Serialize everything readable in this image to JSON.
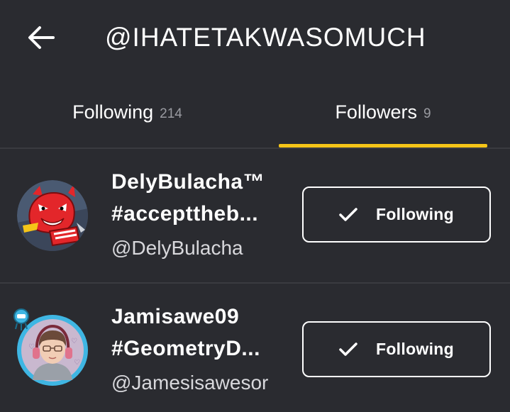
{
  "header": {
    "title": "@IHATETAKWASOMUCH",
    "back_icon": "back-arrow-icon"
  },
  "tabs": [
    {
      "label": "Following",
      "count": "214",
      "active": false
    },
    {
      "label": "Followers",
      "count": "9",
      "active": true
    }
  ],
  "colors": {
    "background": "#2a2b30",
    "accent": "#f5c518",
    "divider": "#3a3b40"
  },
  "users": [
    {
      "name_line1": "DelyBulacha™",
      "name_line2": "#accepttheb...",
      "handle": "@DelyBulacha",
      "button_label": "Following",
      "button_icon": "check-icon"
    },
    {
      "name_line1": "Jamisawe09",
      "name_line2": "#GeometryD...",
      "handle": "@Jamesisawesor",
      "button_label": "Following",
      "button_icon": "check-icon"
    }
  ]
}
